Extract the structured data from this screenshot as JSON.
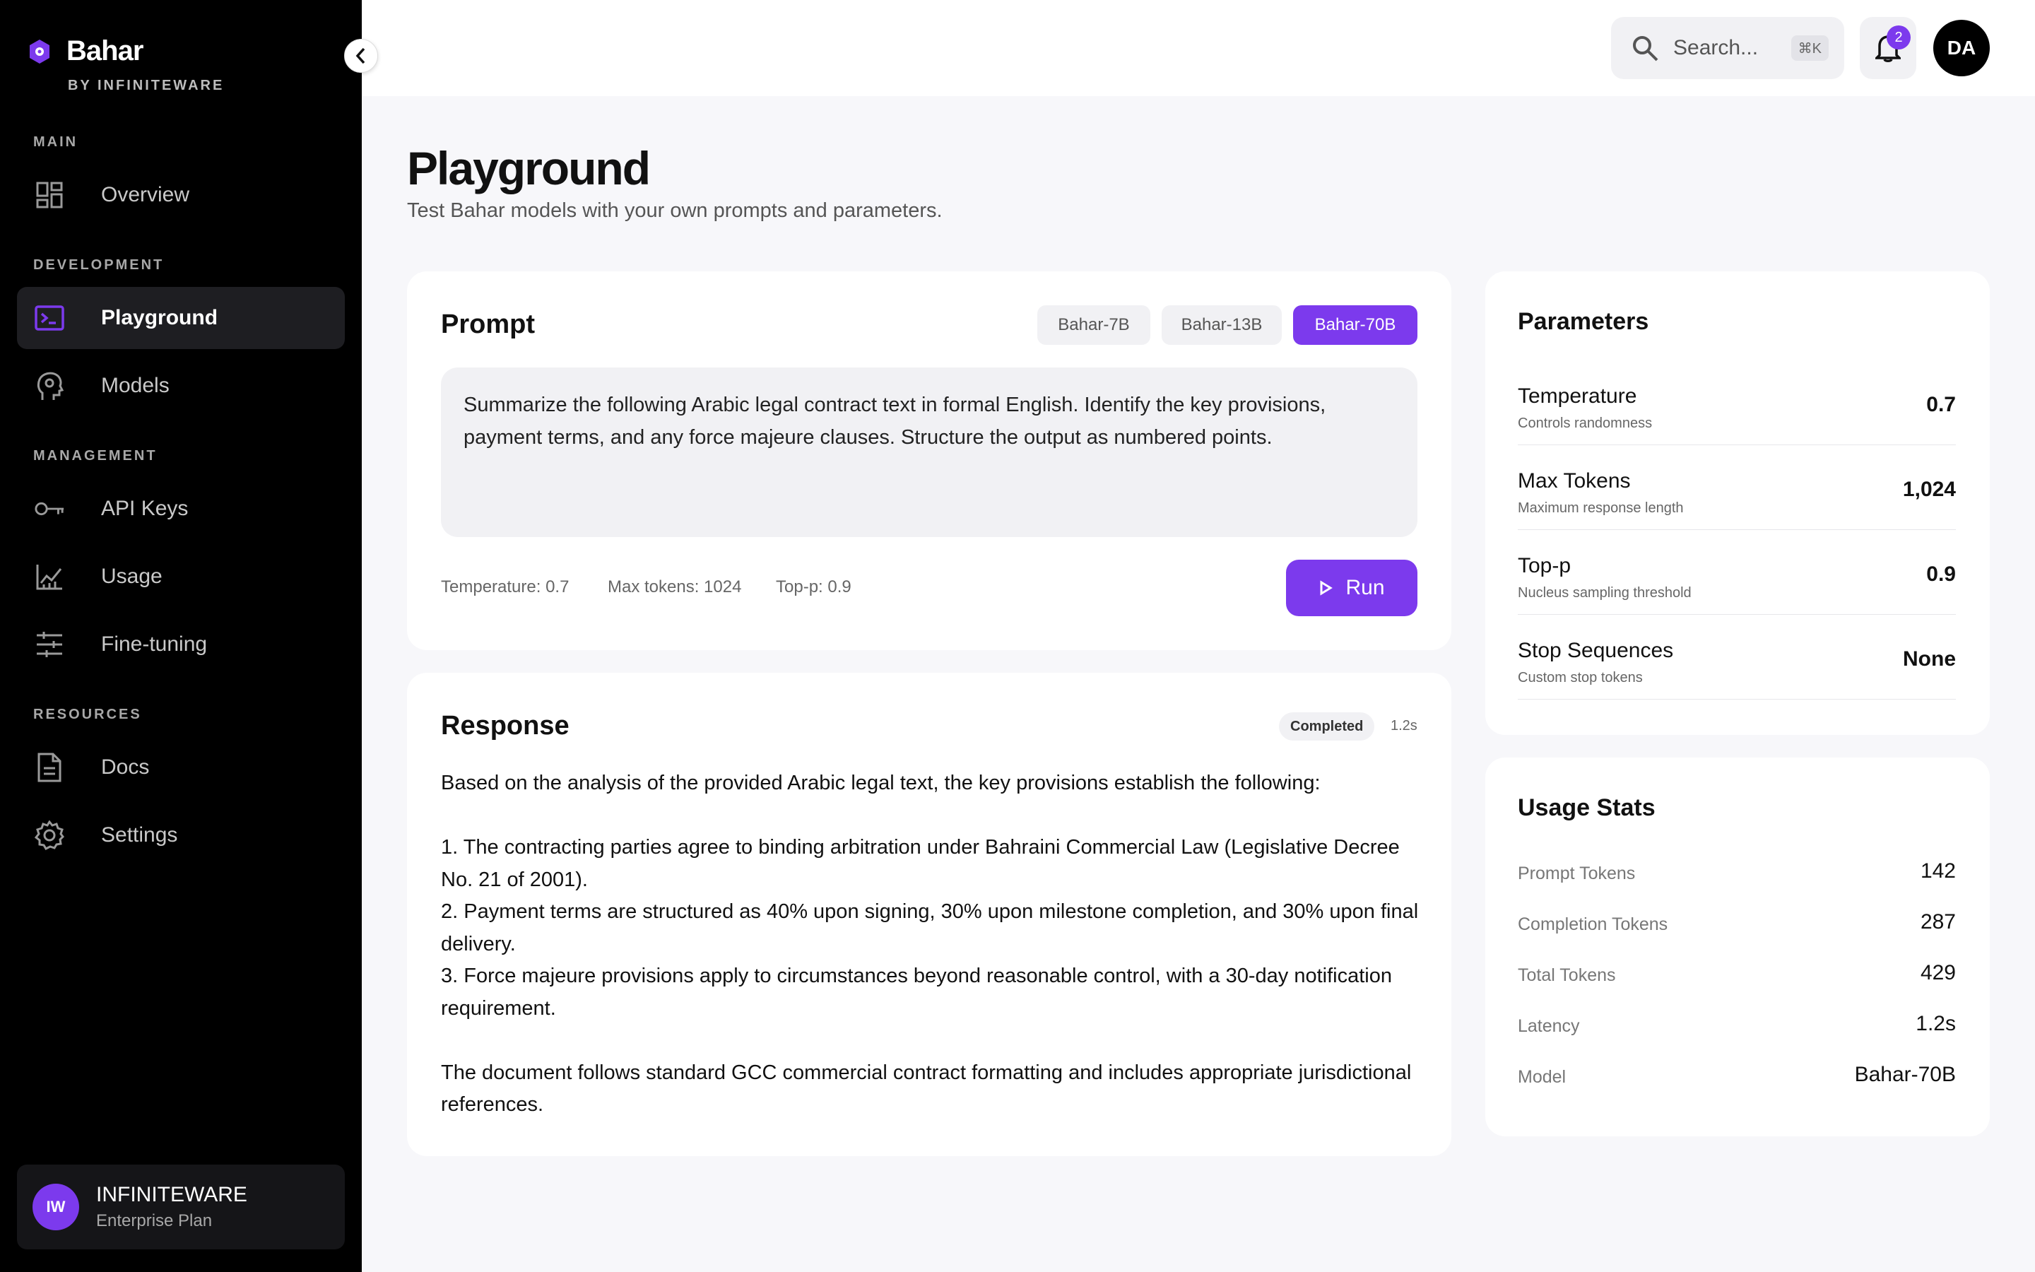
{
  "brand": {
    "name": "Bahar",
    "subtitle": "BY INFINITEWARE"
  },
  "sidebar": {
    "sections": [
      {
        "label": "MAIN"
      },
      {
        "label": "DEVELOPMENT"
      },
      {
        "label": "MANAGEMENT"
      },
      {
        "label": "RESOURCES"
      }
    ],
    "items": [
      {
        "label": "Overview",
        "icon": "dashboard-icon"
      },
      {
        "label": "Playground",
        "icon": "terminal-icon",
        "active": true
      },
      {
        "label": "Models",
        "icon": "brain-icon"
      },
      {
        "label": "API Keys",
        "icon": "key-icon"
      },
      {
        "label": "Usage",
        "icon": "chart-icon"
      },
      {
        "label": "Fine-tuning",
        "icon": "sliders-icon"
      },
      {
        "label": "Docs",
        "icon": "document-icon"
      },
      {
        "label": "Settings",
        "icon": "gear-icon"
      }
    ],
    "org": {
      "initials": "IW",
      "name": "INFINITEWARE",
      "plan": "Enterprise Plan"
    }
  },
  "topbar": {
    "search_placeholder": "Search...",
    "search_shortcut": "⌘K",
    "notification_count": "2",
    "user_initials": "DA"
  },
  "page": {
    "title": "Playground",
    "subtitle": "Test Bahar models with your own prompts and parameters."
  },
  "prompt": {
    "title": "Prompt",
    "models": [
      "Bahar-7B",
      "Bahar-13B",
      "Bahar-70B"
    ],
    "selected_model": "Bahar-70B",
    "text": "Summarize the following Arabic legal contract text in formal English. Identify the key provisions, payment terms, and any force majeure clauses. Structure the output as numbered points.",
    "inline_params": [
      "Temperature: 0.7",
      "Max tokens: 1024",
      "Top-p: 0.9"
    ],
    "run_label": "Run"
  },
  "response": {
    "title": "Response",
    "status": "Completed",
    "latency": "1.2s",
    "intro": "Based on the analysis of the provided Arabic legal text, the key provisions establish the following:",
    "points": [
      "1. The contracting parties agree to binding arbitration under Bahraini Commercial Law (Legislative Decree No. 21 of 2001).",
      "2. Payment terms are structured as 40% upon signing, 30% upon milestone completion, and 30% upon final delivery.",
      "3. Force majeure provisions apply to circumstances beyond reasonable control, with a 30-day notification requirement."
    ],
    "closing": "The document follows standard GCC commercial contract formatting and includes appropriate jurisdictional references."
  },
  "parameters": {
    "title": "Parameters",
    "items": [
      {
        "name": "Temperature",
        "desc": "Controls randomness",
        "value": "0.7"
      },
      {
        "name": "Max Tokens",
        "desc": "Maximum response length",
        "value": "1,024"
      },
      {
        "name": "Top-p",
        "desc": "Nucleus sampling threshold",
        "value": "0.9"
      },
      {
        "name": "Stop Sequences",
        "desc": "Custom stop tokens",
        "value": "None"
      }
    ]
  },
  "usage": {
    "title": "Usage Stats",
    "items": [
      {
        "label": "Prompt Tokens",
        "value": "142"
      },
      {
        "label": "Completion Tokens",
        "value": "287"
      },
      {
        "label": "Total Tokens",
        "value": "429"
      },
      {
        "label": "Latency",
        "value": "1.2s"
      },
      {
        "label": "Model",
        "value": "Bahar-70B"
      }
    ]
  },
  "colors": {
    "accent": "#7c3aed",
    "sidebar_bg": "#000000",
    "page_bg": "#f7f7fa"
  }
}
